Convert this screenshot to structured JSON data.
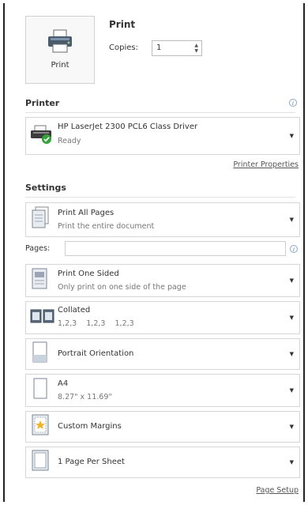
{
  "print": {
    "button_label": "Print",
    "heading": "Print",
    "copies_label": "Copies:",
    "copies_value": "1"
  },
  "printer": {
    "heading": "Printer",
    "name": "HP LaserJet 2300 PCL6 Class Driver",
    "status": "Ready",
    "properties_link": "Printer Properties"
  },
  "settings": {
    "heading": "Settings",
    "pages_label": "Pages:",
    "items": [
      {
        "title": "Print All Pages",
        "subtitle": "Print the entire document",
        "icon": "pages-icon"
      },
      {
        "title": "Print One Sided",
        "subtitle": "Only print on one side of the page",
        "icon": "one-sided-icon"
      },
      {
        "title": "Collated",
        "subtitle": "1,2,3    1,2,3    1,2,3",
        "icon": "collated-icon"
      },
      {
        "title": "Portrait Orientation",
        "subtitle": "",
        "icon": "portrait-icon"
      },
      {
        "title": "A4",
        "subtitle": "8.27\" x 11.69\"",
        "icon": "paper-size-icon"
      },
      {
        "title": "Custom Margins",
        "subtitle": "",
        "icon": "margins-icon"
      },
      {
        "title": "1 Page Per Sheet",
        "subtitle": "",
        "icon": "pages-per-sheet-icon"
      }
    ],
    "page_setup_link": "Page Setup"
  }
}
